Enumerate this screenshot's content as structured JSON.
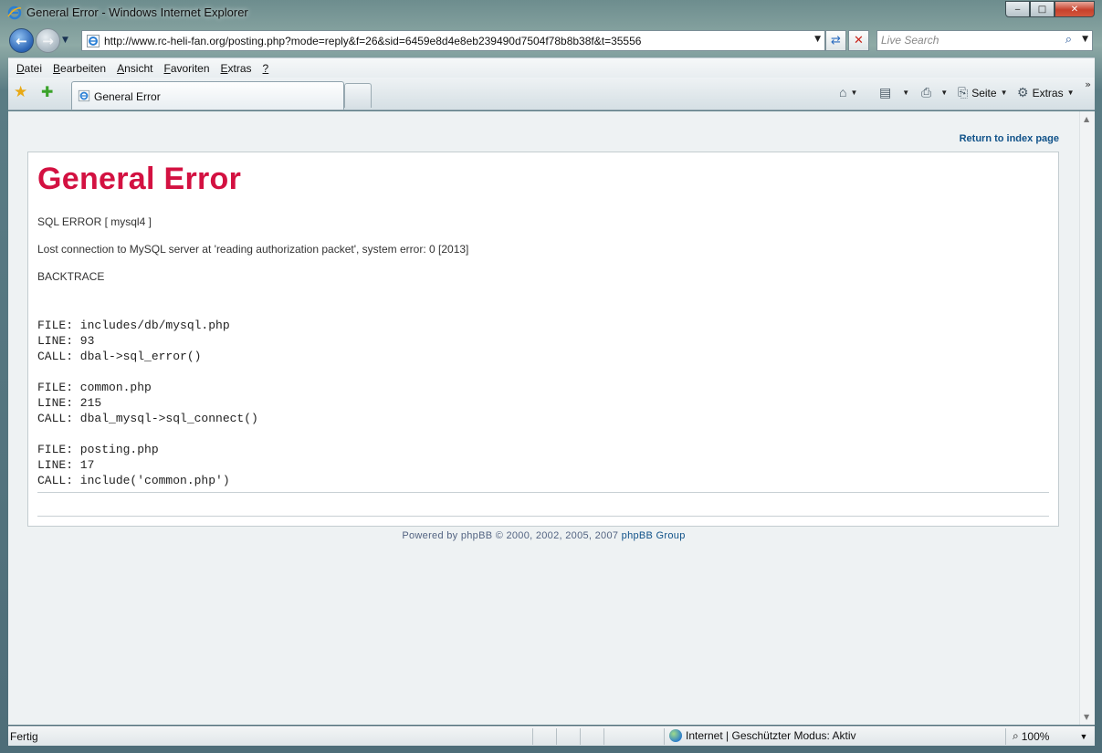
{
  "window": {
    "title": "General Error - Windows Internet Explorer"
  },
  "address_bar": {
    "url": "http://www.rc-heli-fan.org/posting.php?mode=reply&f=26&sid=6459e8d4e8eb239490d7504f78b8b38f&t=35556"
  },
  "search": {
    "placeholder": "Live Search"
  },
  "menu": {
    "items": [
      {
        "key": "D",
        "rest": "atei"
      },
      {
        "key": "B",
        "rest": "earbeiten"
      },
      {
        "key": "A",
        "rest": "nsicht"
      },
      {
        "key": "F",
        "rest": "avoriten"
      },
      {
        "key": "E",
        "rest": "xtras"
      },
      {
        "key": "?",
        "rest": ""
      }
    ]
  },
  "tab": {
    "label": "General Error"
  },
  "command_bar": {
    "page_label": "Seite",
    "tools_label": "Extras",
    "more": "»"
  },
  "page": {
    "return_link": "Return to index page",
    "error_title": "General Error",
    "sql_error": "SQL ERROR [ mysql4 ]",
    "message": "Lost connection to MySQL server at 'reading authorization packet', system error: 0 [2013]",
    "backtrace_label": "BACKTRACE",
    "backtrace": [
      {
        "file": "FILE: includes/db/mysql.php",
        "line": "LINE: 93",
        "call": "CALL: dbal->sql_error()"
      },
      {
        "file": "FILE: common.php",
        "line": "LINE: 215",
        "call": "CALL: dbal_mysql->sql_connect()"
      },
      {
        "file": "FILE: posting.php",
        "line": "LINE: 17",
        "call": "CALL: include('common.php')"
      }
    ],
    "footer_prefix": "Powered by phpBB © 2000, 2002, 2005, 2007",
    "footer_link": "phpBB Group"
  },
  "status_bar": {
    "status": "Fertig",
    "zone": "Internet | Geschützter Modus: Aktiv",
    "zoom": "100%"
  },
  "colors": {
    "error_title": "#d31141",
    "link": "#105289",
    "page_background": "#eef2f3"
  }
}
